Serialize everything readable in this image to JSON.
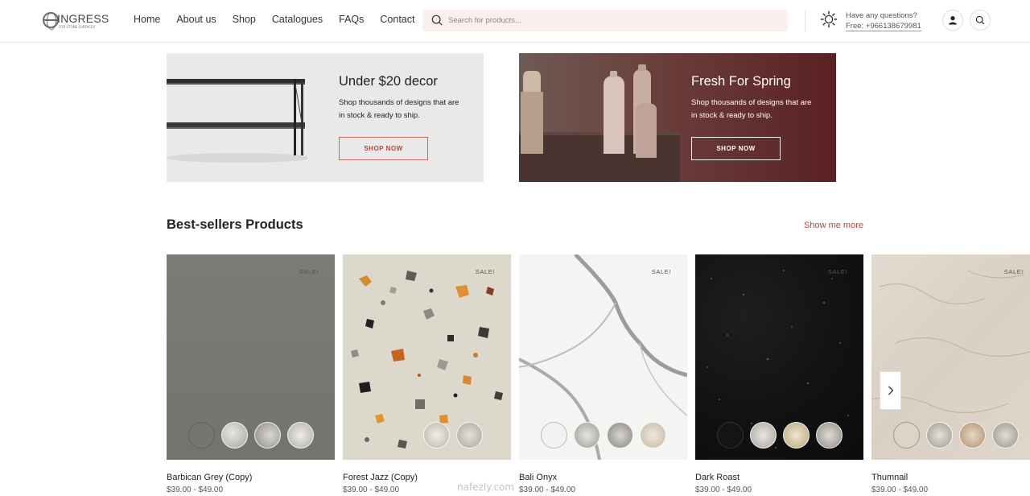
{
  "header": {
    "logo_text": "INGRESS",
    "logo_subtext": "FOR STONE SURFACES",
    "nav": [
      "Home",
      "About us",
      "Shop",
      "Catalogues",
      "FAQs",
      "Contact"
    ],
    "search_placeholder": "Search for products...",
    "support_question": "Have any questions?",
    "support_phone": "Free: +966138679981"
  },
  "banners": [
    {
      "title": "Under $20 decor",
      "text": "Shop thousands of designs that are in stock & ready to ship.",
      "button": "SHOP NOW"
    },
    {
      "title": "Fresh For Spring",
      "text": "Shop thousands of designs that are in stock & ready to ship.",
      "button": "SHOP NOW"
    }
  ],
  "bestsellers": {
    "title": "Best-sellers Products",
    "show_more": "Show me more",
    "products": [
      {
        "name": "Barbican Grey (Copy)",
        "price": "$39.00 - $49.00",
        "badge": "SALE!"
      },
      {
        "name": "Forest Jazz (Copy)",
        "price": "$39.00 - $49.00",
        "badge": "SALE!"
      },
      {
        "name": "Bali Onyx",
        "price": "$39.00 - $49.00",
        "badge": "SALE!"
      },
      {
        "name": "Dark Roast",
        "price": "$39.00 - $49.00",
        "badge": "SALE!"
      },
      {
        "name": "Thumnail",
        "price": "$39.00 - $49.00",
        "badge": "SALE!"
      }
    ]
  },
  "watermark": "nafezly.com",
  "colors": {
    "accent": "#b8473a",
    "search_bg": "#fbefee",
    "banner_left_bg": "#e9e9e8",
    "banner_right_bg": "#5a2124"
  }
}
